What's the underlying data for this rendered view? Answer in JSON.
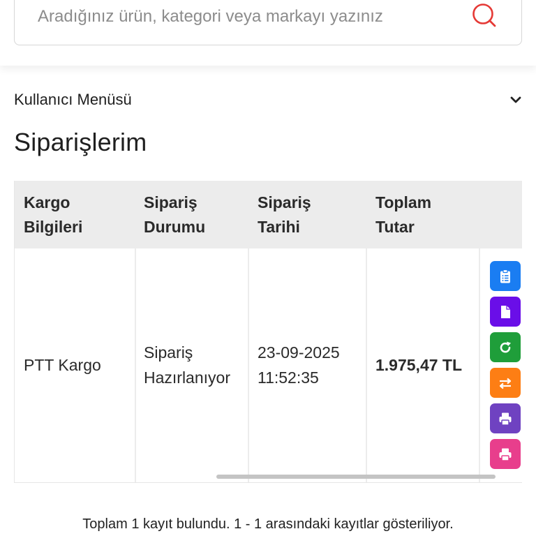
{
  "search": {
    "placeholder": "Aradığınız ürün, kategori veya markayı yazınız",
    "value": ""
  },
  "user_menu": {
    "label": "Kullanıcı Menüsü",
    "icon": "chevron-down-icon"
  },
  "page": {
    "title": "Siparişlerim"
  },
  "table": {
    "headers": [
      {
        "line1": "Kargo",
        "line2": "Bilgileri"
      },
      {
        "line1": "Sipariş",
        "line2": "Durumu"
      },
      {
        "line1": "Sipariş",
        "line2": "Tarihi"
      },
      {
        "line1": "Toplam",
        "line2": "Tutar"
      }
    ],
    "rows": [
      {
        "cargo": "PTT Kargo",
        "status_line1": "Sipariş",
        "status_line2": "Hazırlanıyor",
        "date": "23-09-2025",
        "time": "11:52:35",
        "total": "1.975,47 TL"
      }
    ],
    "actions": [
      {
        "icon": "clipboard-list-icon",
        "color": "#1a7df2"
      },
      {
        "icon": "document-icon",
        "color": "#6a0ee8"
      },
      {
        "icon": "refresh-icon",
        "color": "#1f9e3a"
      },
      {
        "icon": "exchange-icon",
        "color": "#fd7e14"
      },
      {
        "icon": "printer-icon",
        "color": "#6f42c1"
      },
      {
        "icon": "printer-icon",
        "color": "#e83e8c"
      }
    ]
  },
  "footer": {
    "info": "Toplam 1 kayıt bulundu. 1 - 1 arasındaki kayıtlar gösteriliyor."
  },
  "colors": {
    "search_icon": "#e53935",
    "table_header_bg": "#ececec"
  }
}
